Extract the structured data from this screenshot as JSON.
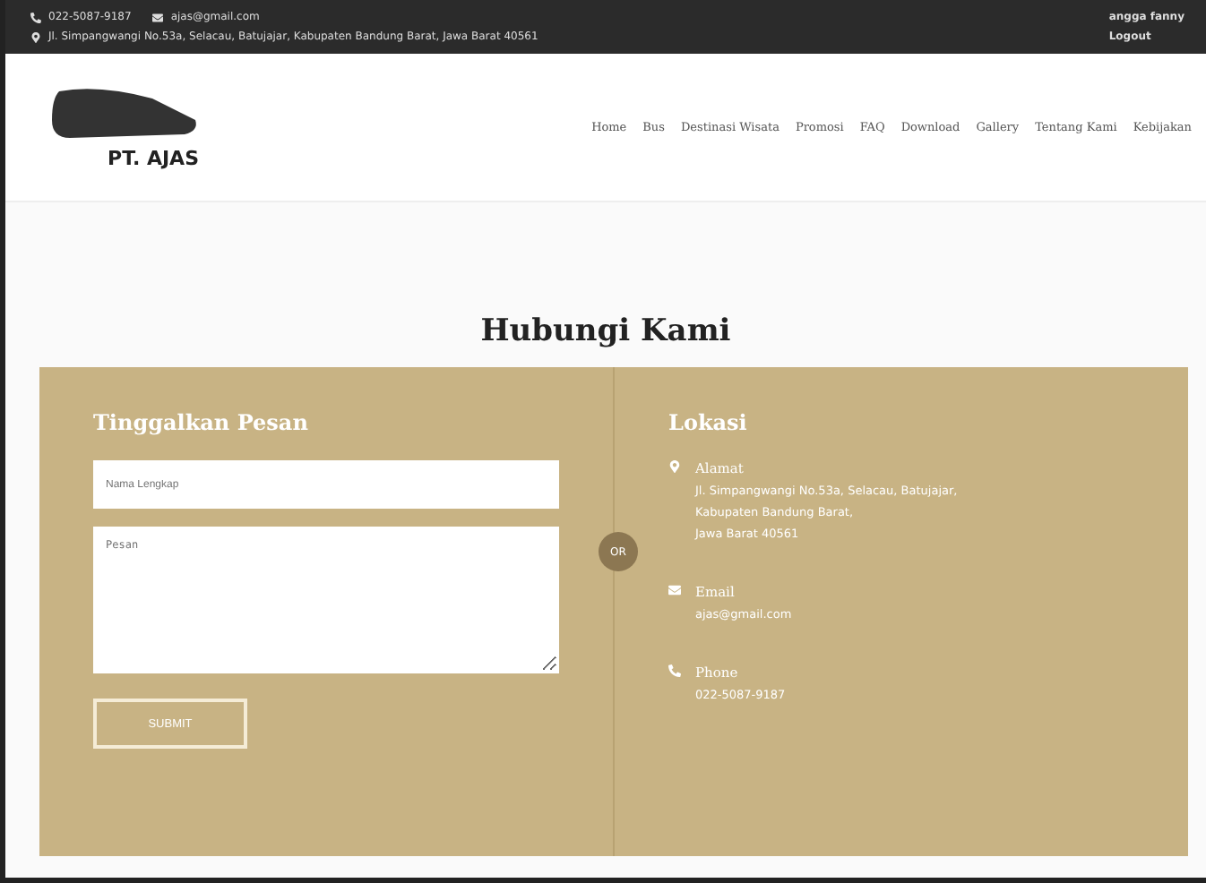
{
  "topbar": {
    "phone": "022-5087-9187",
    "email": "ajas@gmail.com",
    "address": "Jl. Simpangwangi No.53a, Selacau, Batujajar, Kabupaten Bandung Barat, Jawa Barat 40561",
    "user": "angga fanny",
    "logout": "Logout"
  },
  "brand": {
    "name": "PT. AJAS"
  },
  "nav": [
    {
      "label": "Home"
    },
    {
      "label": "Bus"
    },
    {
      "label": "Destinasi Wisata"
    },
    {
      "label": "Promosi"
    },
    {
      "label": "FAQ"
    },
    {
      "label": "Download"
    },
    {
      "label": "Gallery"
    },
    {
      "label": "Tentang Kami"
    },
    {
      "label": "Kebijakan"
    }
  ],
  "title": "Hubungi Kami",
  "form": {
    "heading": "Tinggalkan Pesan",
    "name_placeholder": "Nama Lengkap",
    "message_placeholder": "Pesan",
    "submit": "SUBMIT"
  },
  "divider": "OR",
  "location": {
    "heading": "Lokasi",
    "items": [
      {
        "kind": "address",
        "label": "Alamat",
        "lines": [
          "Jl. Simpangwangi No.53a, Selacau, Batujajar,",
          "Kabupaten Bandung Barat,",
          "Jawa Barat 40561"
        ]
      },
      {
        "kind": "email",
        "label": "Email",
        "lines": [
          "ajas@gmail.com"
        ]
      },
      {
        "kind": "phone",
        "label": "Phone",
        "lines": [
          "022-5087-9187"
        ]
      }
    ]
  }
}
